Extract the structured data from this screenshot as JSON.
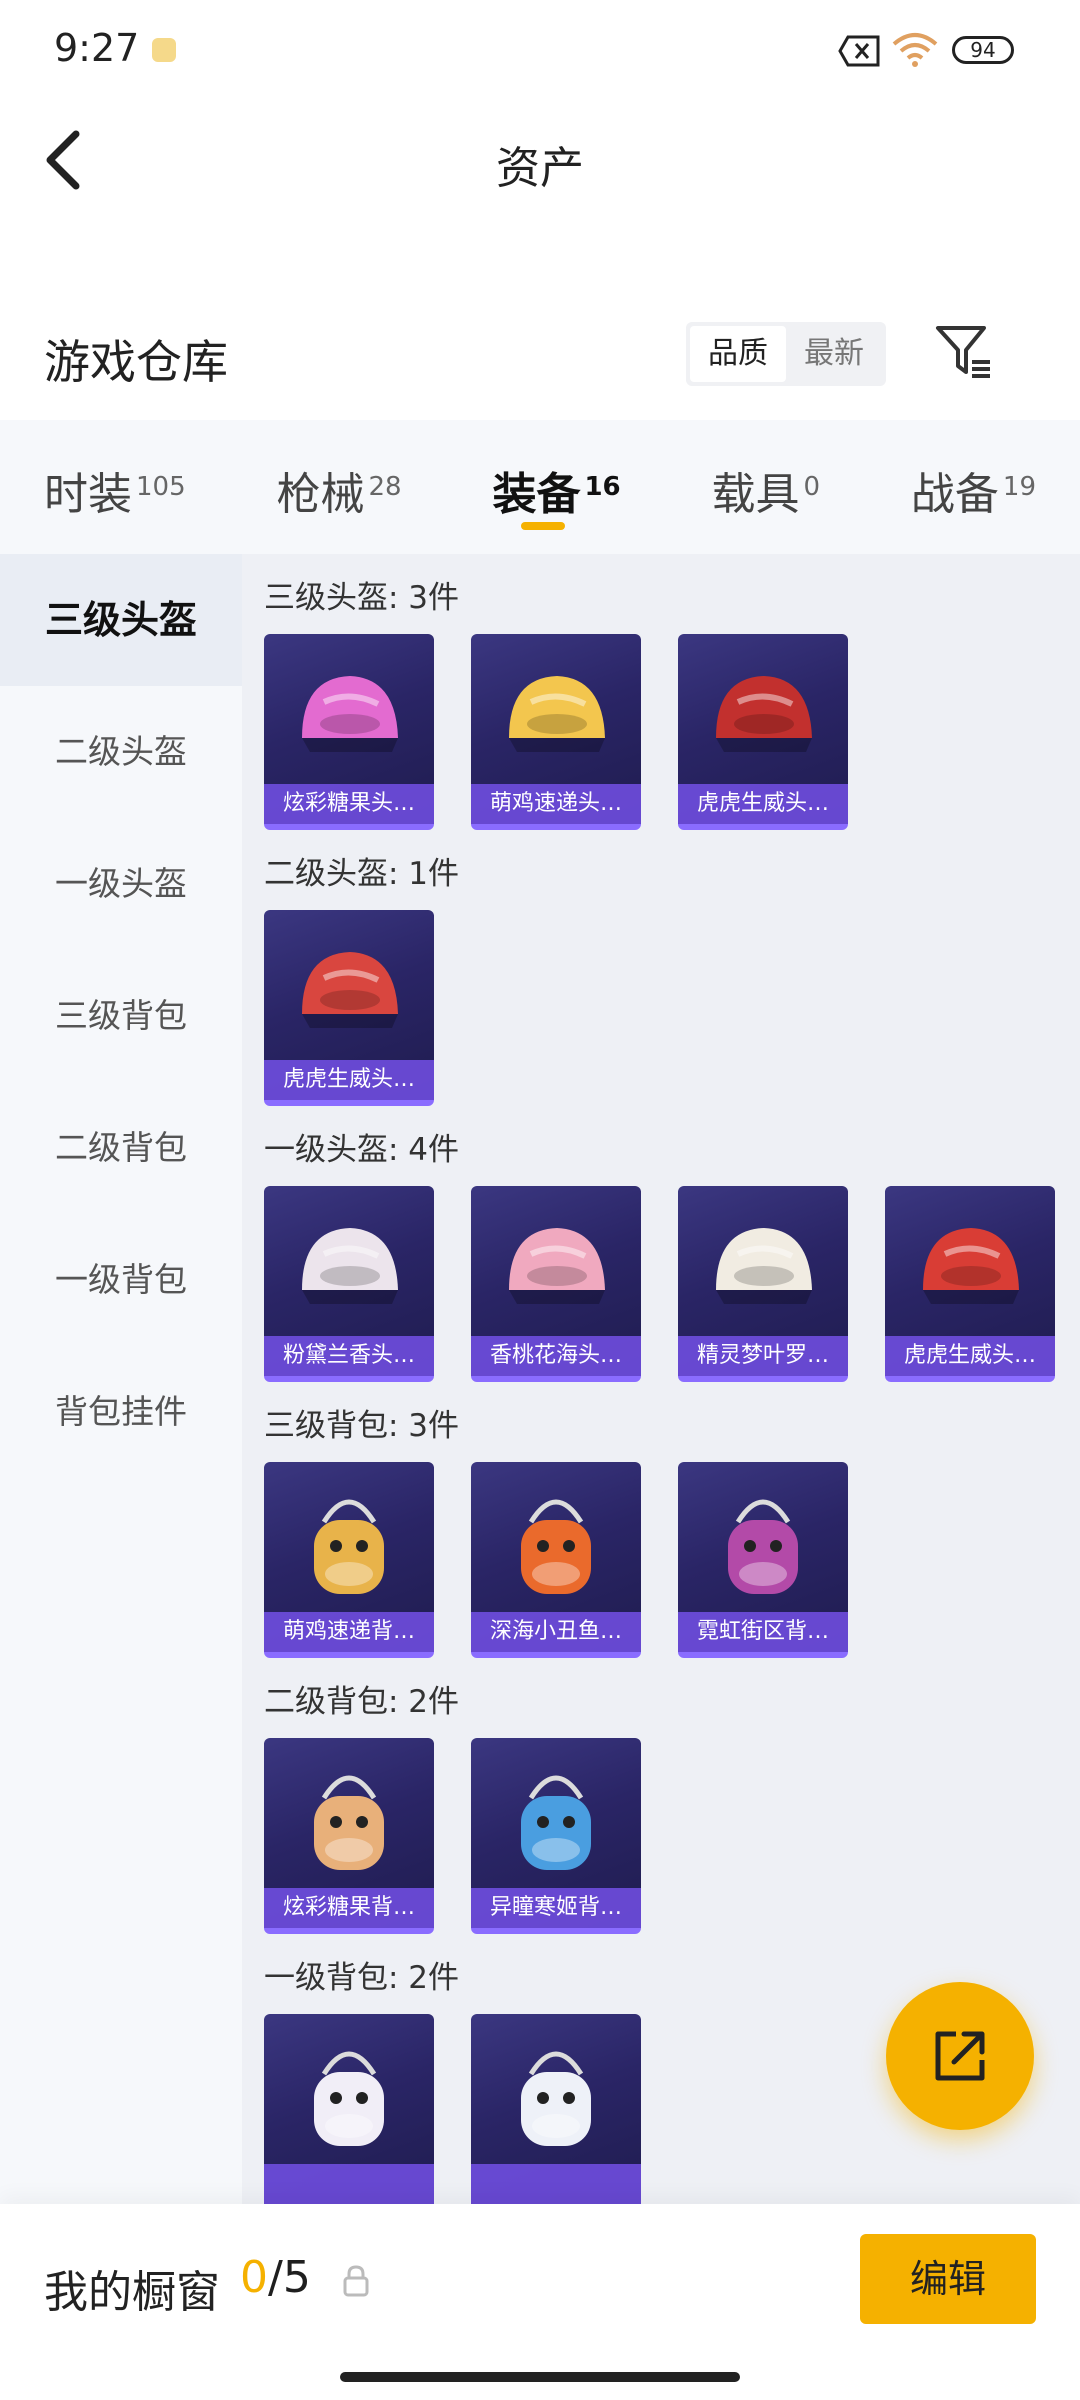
{
  "status": {
    "time": "9:27",
    "battery": "94"
  },
  "header": {
    "title": "资产"
  },
  "warehouse": {
    "title": "游戏仓库",
    "sort": [
      "品质",
      "最新"
    ],
    "active_sort": 0
  },
  "tabs": [
    {
      "label": "时装",
      "count": "105"
    },
    {
      "label": "枪械",
      "count": "28"
    },
    {
      "label": "装备",
      "count": "16"
    },
    {
      "label": "载具",
      "count": "0"
    },
    {
      "label": "战备",
      "count": "19"
    }
  ],
  "active_tab": 2,
  "sidebar": [
    "三级头盔",
    "二级头盔",
    "一级头盔",
    "三级背包",
    "二级背包",
    "一级背包",
    "背包挂件"
  ],
  "active_side": 0,
  "groups": [
    {
      "title": "三级头盔: 3件",
      "items": [
        {
          "name": "炫彩糖果头…",
          "icon": "candy-helmet-icon",
          "color": "#e36bd0"
        },
        {
          "name": "萌鸡速递头…",
          "icon": "chick-helmet-icon",
          "color": "#f3c64e"
        },
        {
          "name": "虎虎生威头…",
          "icon": "tiger-helmet-icon",
          "color": "#c2302e"
        }
      ]
    },
    {
      "title": "二级头盔: 1件",
      "items": [
        {
          "name": "虎虎生威头…",
          "icon": "tiger-helmet-icon",
          "color": "#d9463f"
        }
      ]
    },
    {
      "title": "一级头盔: 4件",
      "items": [
        {
          "name": "粉黛兰香头…",
          "icon": "pink-helmet-icon",
          "color": "#ece4ec"
        },
        {
          "name": "香桃花海头…",
          "icon": "peach-helmet-icon",
          "color": "#f0a9bf"
        },
        {
          "name": "精灵梦叶罗…",
          "icon": "elf-helmet-icon",
          "color": "#f1ece2"
        },
        {
          "name": "虎虎生威头…",
          "icon": "tiger-helmet-icon",
          "color": "#d93d35"
        }
      ]
    },
    {
      "title": "三级背包: 3件",
      "items": [
        {
          "name": "萌鸡速递背…",
          "icon": "chick-backpack-icon",
          "color": "#e8b34a"
        },
        {
          "name": "深海小丑鱼…",
          "icon": "clownfish-backpack-icon",
          "color": "#ea6a2c"
        },
        {
          "name": "霓虹街区背…",
          "icon": "neon-backpack-icon",
          "color": "#b34aa8"
        }
      ]
    },
    {
      "title": "二级背包: 2件",
      "items": [
        {
          "name": "炫彩糖果背…",
          "icon": "candy-backpack-icon",
          "color": "#e8b07a"
        },
        {
          "name": "异瞳寒姬背…",
          "icon": "ice-backpack-icon",
          "color": "#4a9ee0"
        }
      ]
    },
    {
      "title": "一级背包: 2件",
      "items": [
        {
          "name": "",
          "icon": "bunny-backpack-icon",
          "color": "#f1eef7"
        },
        {
          "name": "",
          "icon": "bunny-backpack-icon",
          "color": "#eef1f8"
        }
      ]
    }
  ],
  "bottom": {
    "label": "我的橱窗",
    "count_current": "0",
    "count_total": "/5",
    "edit_label": "编辑"
  },
  "colors": {
    "accent": "#f5b100",
    "card_bg": "#2a2566"
  }
}
